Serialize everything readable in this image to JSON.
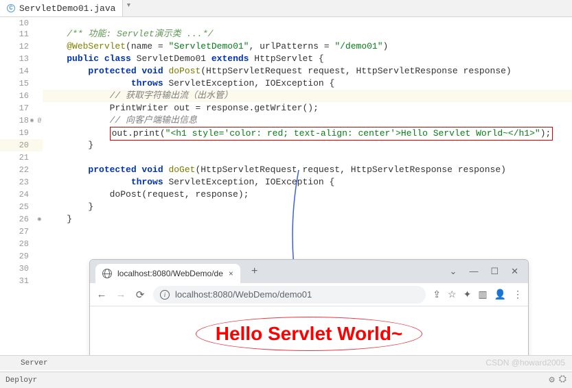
{
  "tab": {
    "icon_letter": "C",
    "name": "ServletDemo01.java",
    "chevron": "▾"
  },
  "gutter": [
    "10",
    "11",
    "12",
    "13",
    "14",
    "15",
    "16",
    "17",
    "18",
    "19",
    "20",
    "21",
    "22",
    "23",
    "24",
    "25",
    "26",
    "27",
    "28",
    "29",
    "30",
    "31"
  ],
  "code": {
    "l10": "",
    "l11_doc": "/** 功能: Servlet演示类 ...*/",
    "l12_annot": "@WebServlet",
    "l12_rest": "(name = \"ServletDemo01\", urlPatterns = \"/demo01\")",
    "l12_s1": "\"ServletDemo01\"",
    "l12_s2": "\"/demo01\"",
    "l13_kw1": "public class",
    "l13_cls": " ServletDemo01 ",
    "l13_kw2": "extends",
    "l13_ext": " HttpServlet {",
    "l14_kw": "protected void",
    "l14_m": " doPost",
    "l14_rest": "(HttpServletRequest request, HttpServletResponse response)",
    "l15_kw": "throws",
    "l15_rest": " ServletException, IOException {",
    "l16_cmt": "// 获取字符输出流（出水管）",
    "l17": "PrintWriter out = response.getWriter();",
    "l18_cmt": "// 向客户端输出信息",
    "l19_a": "out.print(",
    "l19_s": "\"<h1 style='color: red; text-align: center'>Hello Servlet World~</h1>\"",
    "l19_b": ");",
    "l20": "}",
    "l21": "",
    "l22_kw": "protected void",
    "l22_m": " doGet",
    "l22_rest": "(HttpServletRequest request, HttpServletResponse response)",
    "l23_kw": "throws",
    "l23_rest": " ServletException, IOException {",
    "l24": "doPost(request, response);",
    "l25": "}",
    "l26": "}",
    "l27": ""
  },
  "browser": {
    "tab_title": "localhost:8080/WebDemo/de",
    "url": "localhost:8080/WebDemo/demo01",
    "page_text": "Hello Servlet World~"
  },
  "bottom": {
    "server": "Server"
  },
  "status": {
    "deploy": "Deployr",
    "gear": "⚙",
    "settings": "⛭"
  },
  "watermark": "CSDN @howard2005"
}
